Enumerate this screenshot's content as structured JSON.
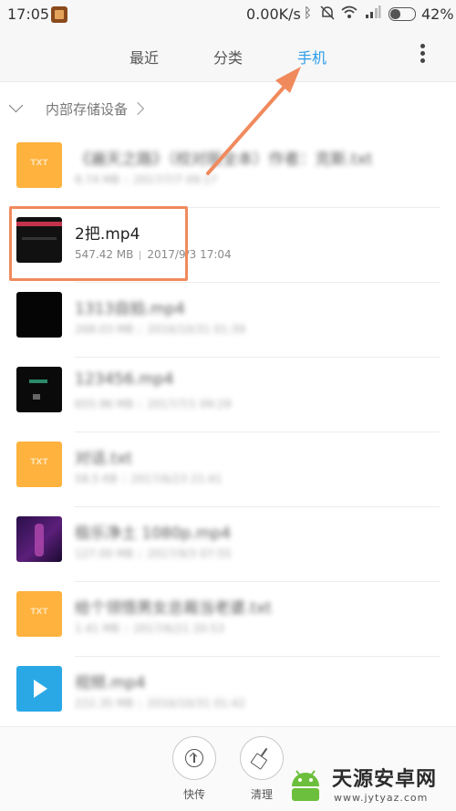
{
  "status_bar": {
    "time": "17:05",
    "network_speed": "0.00K/s",
    "battery_percent": "42%",
    "battery_level": 0.42,
    "icons": [
      "app-notification-icon",
      "bluetooth-icon",
      "do-not-disturb-icon",
      "wifi-icon",
      "signal-icon",
      "battery-icon"
    ]
  },
  "tabs": [
    {
      "label": "最近",
      "active": false
    },
    {
      "label": "分类",
      "active": false
    },
    {
      "label": "手机",
      "active": true
    }
  ],
  "accent_color": "#2d9de8",
  "path": {
    "label": "内部存储设备"
  },
  "files": [
    {
      "name": "《遍天之路》（校对版全本）作者：克斯.txt",
      "size": "8.74 MB",
      "date": "2017/7/7 09:17",
      "type": "txt",
      "blurred": true
    },
    {
      "name": "2把.mp4",
      "size": "547.42 MB",
      "date": "2017/9/3 17:04",
      "type": "video",
      "blurred": false
    },
    {
      "name": "1313自拍.mp4",
      "size": "268.03 MB",
      "date": "2016/10/31 01:39",
      "type": "video-dark",
      "blurred": true
    },
    {
      "name": "123456.mp4",
      "size": "655.96 MB",
      "date": "2017/7/1 09:29",
      "type": "video-dark2",
      "blurred": true
    },
    {
      "name": "对话.txt",
      "size": "58.5 KB",
      "date": "2017/6/23 21:41",
      "type": "txt",
      "blurred": true
    },
    {
      "name": "极乐净土 1080p.mp4",
      "size": "127.00 MB",
      "date": "2017/9/3 07:55",
      "type": "video-purple",
      "blurred": true
    },
    {
      "name": "给个领悟男女总裁当老婆.txt",
      "size": "1.41 MB",
      "date": "2017/6/21 20:53",
      "type": "txt",
      "blurred": true
    },
    {
      "name": "视频.mp4",
      "size": "222.35 MB",
      "date": "2016/10/31 01:42",
      "type": "video-blue",
      "blurred": true
    }
  ],
  "txt_badge": "TXT",
  "bottom": {
    "send_label": "快传",
    "clean_label": "清理"
  },
  "watermark": {
    "name": "天源安卓网",
    "url": "www.jytyaz.com"
  },
  "annotation_color": "#f08a5d"
}
